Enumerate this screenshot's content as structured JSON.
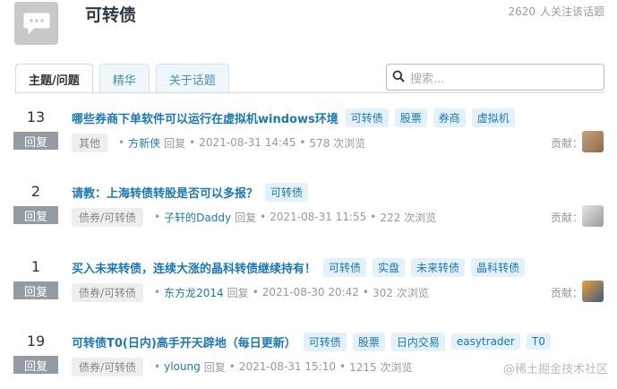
{
  "header": {
    "title": "可转债",
    "followers": "2620",
    "followers_label": "人关注该话题"
  },
  "tabs": [
    {
      "label": "主题/问题"
    },
    {
      "label": "精华"
    },
    {
      "label": "关于话题"
    }
  ],
  "search": {
    "placeholder": "搜索..."
  },
  "questions": [
    {
      "count": "13",
      "reply_label": "回复",
      "title": "哪些券商下单软件可以运行在虚拟机windows环境",
      "tags": [
        "可转债",
        "股票",
        "券商",
        "虚拟机"
      ],
      "category": "其他",
      "author": "方新侠",
      "action": "回复",
      "time": "2021-08-31 14:45",
      "views": "578 次浏览",
      "contrib_label": "贡献："
    },
    {
      "count": "2",
      "reply_label": "回复",
      "title": "请教：上海转债转股是否可以多报？",
      "tags": [
        "可转债"
      ],
      "category": "债券/可转债",
      "author": "子轩的Daddy",
      "action": "回复",
      "time": "2021-08-31 11:55",
      "views": "222 次浏览",
      "contrib_label": "贡献："
    },
    {
      "count": "1",
      "reply_label": "回复",
      "title": "买入未来转债，连续大涨的晶科转债继续持有！",
      "tags": [
        "可转债",
        "实盘",
        "未来转债",
        "晶科转债"
      ],
      "category": "债券/可转债",
      "author": "东方龙2014",
      "action": "回复",
      "time": "2021-08-30 20:42",
      "views": "302 次浏览",
      "contrib_label": "贡献："
    },
    {
      "count": "19",
      "reply_label": "回复",
      "title": "可转债T0(日内)高手开天辟地（每日更新）",
      "tags": [
        "可转债",
        "股票",
        "日内交易",
        "easytrader",
        "T0"
      ],
      "category": "债券/可转债",
      "author": "yloung",
      "action": "回复",
      "time": "2021-08-31 15:10",
      "views": "1215 次浏览",
      "contrib_label": "贡献："
    }
  ],
  "watermark": "@稀土掘金技术社区",
  "colors": {
    "link": "#1a78b9",
    "tag_bg": "#e3f2fa",
    "badge_bg": "#939ca5"
  }
}
